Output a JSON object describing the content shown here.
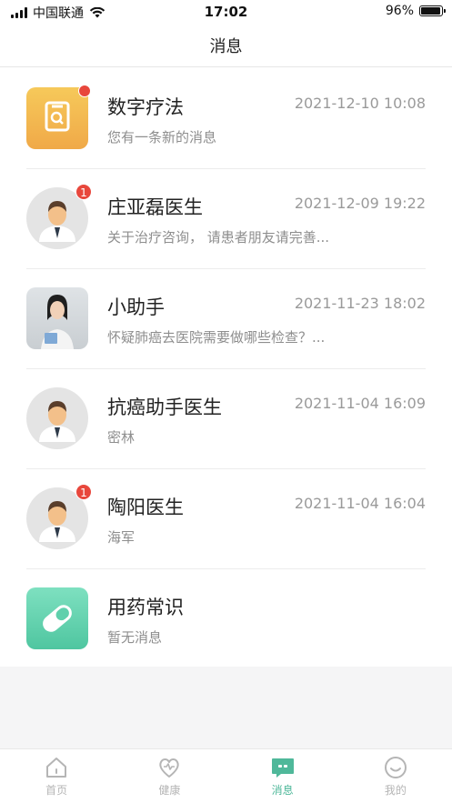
{
  "status_bar": {
    "carrier": "中国联通",
    "time": "17:02",
    "battery": "96%",
    "battery_level": 0.96
  },
  "header": {
    "title": "消息"
  },
  "messages": [
    {
      "name": "数字疗法",
      "time": "2021-12-10 10:08",
      "preview": "您有一条新的消息",
      "avatar": "digital-therapy-icon",
      "badge": ""
    },
    {
      "name": "庄亚磊医生",
      "time": "2021-12-09 19:22",
      "preview": "关于治疗咨询， 请患者朋友请完善...",
      "avatar": "doctor-avatar",
      "badge": "1"
    },
    {
      "name": "小助手",
      "time": "2021-11-23 18:02",
      "preview": "怀疑肺癌去医院需要做哪些检查？...",
      "avatar": "assistant-photo",
      "badge": ""
    },
    {
      "name": "抗癌助手医生",
      "time": "2021-11-04 16:09",
      "preview": "密林",
      "avatar": "doctor-avatar",
      "badge": ""
    },
    {
      "name": "陶阳医生",
      "time": "2021-11-04 16:04",
      "preview": "海军",
      "avatar": "doctor-avatar",
      "badge": "1"
    },
    {
      "name": "用药常识",
      "time": "",
      "preview": "暂无消息",
      "avatar": "pill-icon",
      "badge": ""
    }
  ],
  "tabs": [
    {
      "label": "首页",
      "icon": "home-icon",
      "active": false
    },
    {
      "label": "健康",
      "icon": "heart-icon",
      "active": false
    },
    {
      "label": "消息",
      "icon": "message-icon",
      "active": true
    },
    {
      "label": "我的",
      "icon": "profile-icon",
      "active": false
    }
  ],
  "colors": {
    "accent": "#4fb89a",
    "badge": "#e8473c",
    "digital_therapy": "#f2b84b",
    "pill": "#5fd0ac"
  }
}
